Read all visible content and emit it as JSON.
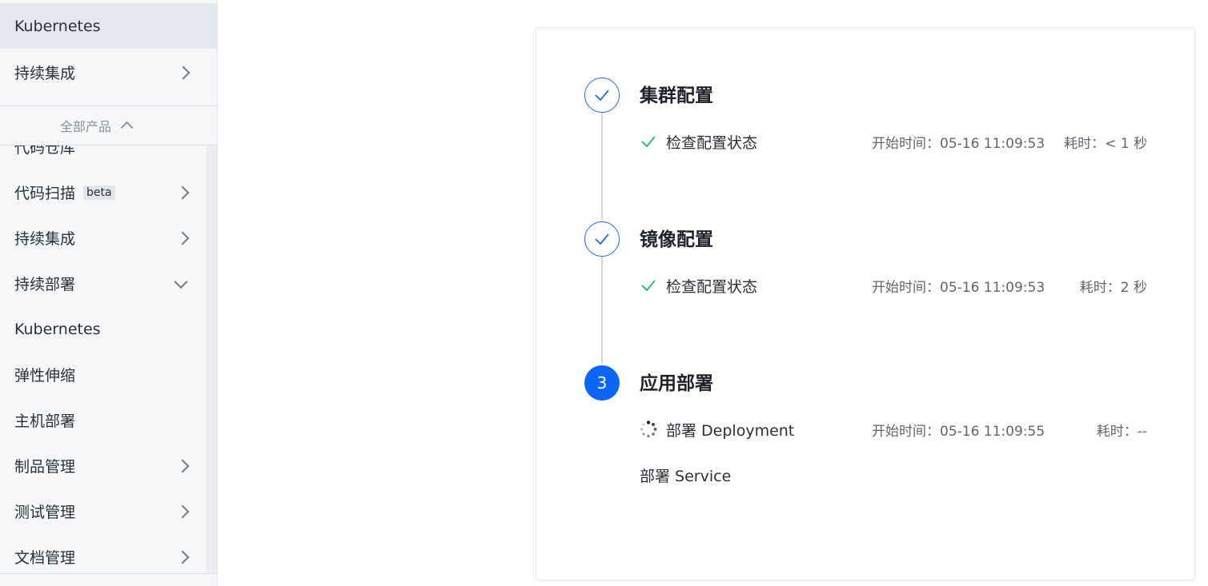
{
  "sidebar": {
    "top_items": [
      {
        "label": "Kubernetes",
        "has_chevron": false
      },
      {
        "label": "持续集成",
        "has_chevron": true
      }
    ],
    "all_products_label": "全部产品",
    "items": [
      {
        "label": "代码仓库"
      },
      {
        "label": "代码扫描",
        "badge": "beta"
      },
      {
        "label": "持续集成"
      },
      {
        "label": "持续部署"
      },
      {
        "label": "Kubernetes"
      },
      {
        "label": "弹性伸缩"
      },
      {
        "label": "主机部署"
      },
      {
        "label": "制品管理"
      },
      {
        "label": "测试管理"
      },
      {
        "label": "文档管理"
      }
    ]
  },
  "steps": [
    {
      "marker": "",
      "status": "done",
      "title": "集群配置",
      "tasks": [
        {
          "name": "检查配置状态",
          "start": "开始时间：05-16 11:09:53",
          "duration": "耗时：< 1 秒",
          "status": "success"
        }
      ]
    },
    {
      "marker": "",
      "status": "done",
      "title": "镜像配置",
      "tasks": [
        {
          "name": "检查配置状态",
          "start": "开始时间：05-16 11:09:53",
          "duration": "耗时：2 秒",
          "status": "success"
        }
      ]
    },
    {
      "marker": "3",
      "status": "active",
      "title": "应用部署",
      "tasks": [
        {
          "name": "部署 Deployment",
          "start": "开始时间：05-16 11:09:55",
          "duration": "耗时：--",
          "status": "running"
        },
        {
          "name": "部署 Service",
          "start": "",
          "duration": "",
          "status": "pending"
        }
      ]
    }
  ],
  "colors": {
    "primary": "#0b65f5",
    "success": "#2fbf71",
    "sidebar_bg": "#f6f7f9",
    "sidebar_active": "#e4e7ef"
  }
}
